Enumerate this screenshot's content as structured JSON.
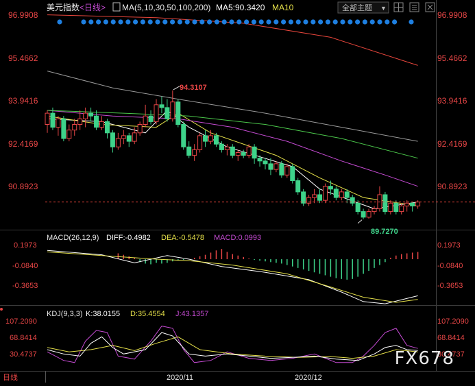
{
  "header": {
    "instrument": "美元指数",
    "period": "<日线>",
    "ma_label": "MA(5,10,30,50,100,200)",
    "ma5_label": "MA5:90.3420",
    "ma10_label": "MA10",
    "theme_button": "全部主题",
    "theme_arrow": "▼",
    "icon_names": [
      "grid-icon",
      "settings-icon"
    ]
  },
  "colors": {
    "background": "#000000",
    "up": "#e84646",
    "down": "#3ed38a",
    "ma5": "#ffffff",
    "ma10": "#e6e14a",
    "ma30": "#c54bd3",
    "ma50": "#4bc84b",
    "ma100": "#9a9a9a",
    "ma200": "#e8463c",
    "axis_text": "#e84646",
    "label_green": "#3ed38a",
    "dea": "#e6e14a",
    "macd_hist": "#c54bd3",
    "kdj_k": "#ffffff",
    "kdj_d": "#e6e14a",
    "kdj_j": "#c54bd3",
    "marker": "#1e7fe0"
  },
  "price_axis": [
    "96.9908",
    "95.4662",
    "93.9416",
    "92.4169",
    "90.8923"
  ],
  "annotations": {
    "high": "94.3107",
    "low": "89.7270"
  },
  "macd": {
    "label": "MACD(26,12,9)",
    "diff_label": "DIFF:-0.4982",
    "dea_label": "DEA:-0.5478",
    "macd_label": "MACD:0.0993",
    "axis": [
      "0.1973",
      "-0.0840",
      "-0.3653"
    ]
  },
  "kdj": {
    "label": "KDJ(9,3,3)",
    "k_label": "K:38.0155",
    "d_label": "D:35.4554",
    "j_label": "J:43.1357",
    "axis": [
      "107.2090",
      "68.8414",
      "30.4737"
    ]
  },
  "x_axis": {
    "dates": [
      "2020/11",
      "2020/12"
    ],
    "period_label": "日线"
  },
  "watermark": "FX678",
  "chart_data": {
    "type": "candlestick",
    "title": "美元指数 <日线>",
    "y_range": [
      89.3,
      97.1
    ],
    "y_ticks": [
      96.9908,
      95.4662,
      93.9416,
      92.4169,
      90.8923
    ],
    "x_ticks": {
      "2020/11": 45,
      "2020/12": 65
    },
    "candles": [
      [
        93.1,
        93.5,
        92.8,
        93.6
      ],
      [
        93.5,
        93.0,
        92.9,
        93.7
      ],
      [
        93.0,
        93.3,
        92.7,
        93.4
      ],
      [
        93.3,
        92.6,
        92.5,
        93.4
      ],
      [
        92.6,
        92.9,
        92.5,
        93.1
      ],
      [
        92.9,
        93.1,
        92.7,
        93.3
      ],
      [
        93.1,
        93.3,
        92.9,
        93.6
      ],
      [
        93.3,
        93.5,
        93.0,
        93.7
      ],
      [
        93.5,
        93.4,
        93.2,
        93.7
      ],
      [
        93.4,
        93.0,
        92.9,
        93.6
      ],
      [
        93.0,
        93.2,
        92.9,
        93.4
      ],
      [
        93.2,
        92.8,
        92.6,
        93.3
      ],
      [
        92.8,
        92.3,
        92.1,
        92.9
      ],
      [
        92.3,
        92.6,
        92.2,
        92.8
      ],
      [
        92.6,
        92.7,
        92.4,
        92.9
      ],
      [
        92.7,
        92.5,
        92.3,
        92.8
      ],
      [
        92.5,
        92.8,
        92.4,
        93.0
      ],
      [
        92.8,
        93.1,
        92.7,
        93.2
      ],
      [
        93.1,
        93.4,
        93.0,
        93.8
      ],
      [
        93.4,
        93.2,
        93.1,
        93.6
      ],
      [
        93.2,
        93.8,
        93.1,
        94.0
      ],
      [
        93.8,
        93.7,
        93.5,
        94.1
      ],
      [
        93.7,
        93.3,
        93.2,
        94.0
      ],
      [
        93.3,
        93.9,
        93.2,
        94.31
      ],
      [
        93.9,
        93.1,
        93.0,
        94.0
      ],
      [
        93.1,
        92.3,
        92.2,
        93.2
      ],
      [
        92.3,
        92.0,
        91.9,
        92.5
      ],
      [
        92.0,
        92.2,
        91.8,
        92.4
      ],
      [
        92.2,
        92.7,
        92.1,
        92.8
      ],
      [
        92.7,
        92.5,
        92.3,
        92.9
      ],
      [
        92.5,
        92.7,
        92.4,
        92.9
      ],
      [
        92.7,
        92.4,
        92.3,
        92.8
      ],
      [
        92.4,
        92.2,
        92.1,
        92.5
      ],
      [
        92.2,
        92.3,
        92.0,
        92.4
      ],
      [
        92.3,
        92.0,
        91.9,
        92.4
      ],
      [
        92.0,
        92.1,
        91.8,
        92.2
      ],
      [
        92.1,
        92.0,
        91.9,
        92.2
      ],
      [
        92.0,
        92.3,
        91.9,
        92.4
      ],
      [
        92.3,
        91.9,
        91.7,
        92.4
      ],
      [
        91.9,
        91.8,
        91.6,
        92.0
      ],
      [
        91.8,
        91.7,
        91.5,
        91.9
      ],
      [
        91.7,
        91.5,
        91.3,
        91.9
      ],
      [
        91.5,
        91.7,
        91.4,
        91.8
      ],
      [
        91.7,
        91.3,
        91.2,
        91.8
      ],
      [
        91.3,
        91.6,
        91.2,
        91.7
      ],
      [
        91.6,
        91.1,
        91.0,
        91.7
      ],
      [
        91.1,
        90.7,
        90.6,
        91.2
      ],
      [
        90.7,
        90.3,
        90.2,
        90.8
      ],
      [
        90.3,
        90.5,
        90.2,
        90.6
      ],
      [
        90.5,
        90.6,
        90.3,
        90.8
      ],
      [
        90.6,
        90.4,
        90.3,
        90.8
      ],
      [
        90.4,
        90.9,
        90.3,
        91.0
      ],
      [
        90.9,
        90.8,
        90.6,
        91.1
      ],
      [
        90.8,
        90.5,
        90.4,
        90.9
      ],
      [
        90.5,
        90.7,
        90.4,
        90.8
      ],
      [
        90.7,
        90.5,
        90.3,
        90.8
      ],
      [
        90.5,
        90.3,
        90.2,
        90.6
      ],
      [
        90.3,
        90.0,
        89.9,
        90.4
      ],
      [
        90.0,
        89.8,
        89.73,
        90.1
      ],
      [
        89.8,
        90.0,
        89.75,
        90.1
      ],
      [
        90.0,
        90.1,
        89.9,
        90.2
      ],
      [
        90.1,
        90.6,
        90.0,
        90.9
      ],
      [
        90.6,
        90.0,
        89.9,
        90.7
      ],
      [
        90.0,
        90.3,
        89.9,
        90.4
      ],
      [
        90.3,
        90.0,
        89.9,
        90.4
      ],
      [
        90.0,
        90.2,
        89.9,
        90.3
      ],
      [
        90.2,
        90.3,
        90.0,
        90.4
      ],
      [
        90.3,
        90.2,
        90.0,
        90.35
      ],
      [
        90.2,
        90.34,
        90.1,
        90.4
      ]
    ],
    "ma_lines": [
      {
        "name": "MA5",
        "points": [
          [
            0,
            93.3
          ],
          [
            10,
            93.2
          ],
          [
            18,
            92.8
          ],
          [
            22,
            93.6
          ],
          [
            26,
            93.0
          ],
          [
            33,
            92.3
          ],
          [
            45,
            91.6
          ],
          [
            50,
            90.8
          ],
          [
            60,
            90.1
          ],
          [
            68,
            90.34
          ]
        ]
      },
      {
        "name": "MA10",
        "points": [
          [
            0,
            93.4
          ],
          [
            10,
            93.1
          ],
          [
            20,
            93.0
          ],
          [
            24,
            93.5
          ],
          [
            30,
            92.8
          ],
          [
            42,
            92.0
          ],
          [
            50,
            91.2
          ],
          [
            58,
            90.5
          ],
          [
            68,
            90.2
          ]
        ]
      },
      {
        "name": "MA30",
        "points": [
          [
            0,
            93.6
          ],
          [
            12,
            93.4
          ],
          [
            24,
            93.3
          ],
          [
            34,
            93.0
          ],
          [
            44,
            92.5
          ],
          [
            54,
            91.8
          ],
          [
            62,
            91.3
          ],
          [
            68,
            90.9
          ]
        ]
      },
      {
        "name": "MA50",
        "points": [
          [
            0,
            93.6
          ],
          [
            14,
            93.5
          ],
          [
            26,
            93.4
          ],
          [
            40,
            93.1
          ],
          [
            54,
            92.6
          ],
          [
            68,
            91.9
          ]
        ]
      },
      {
        "name": "MA100",
        "points": [
          [
            0,
            95.0
          ],
          [
            12,
            94.4
          ],
          [
            24,
            94.0
          ],
          [
            40,
            93.5
          ],
          [
            54,
            93.0
          ],
          [
            68,
            92.5
          ]
        ]
      },
      {
        "name": "MA200",
        "points": [
          [
            0,
            97.0
          ],
          [
            20,
            96.9
          ],
          [
            36,
            96.7
          ],
          [
            52,
            96.2
          ],
          [
            68,
            95.2
          ]
        ]
      }
    ],
    "macd": {
      "axis_ticks": [
        0.1973,
        -0.084,
        -0.3653
      ],
      "hist": [
        0.08,
        0.06,
        0.04,
        0.02,
        -0.04,
        -0.06,
        -0.07,
        -0.05,
        -0.06,
        -0.05,
        -0.03,
        -0.02,
        -0.01,
        0.0,
        0.02,
        0.04,
        0.06,
        0.09,
        0.12,
        0.14,
        0.1,
        0.07,
        0.05,
        0.03,
        0.01,
        -0.01,
        -0.02,
        -0.03,
        -0.04,
        -0.05,
        -0.06,
        -0.08,
        -0.1,
        -0.12,
        -0.14,
        -0.16,
        -0.18,
        -0.2,
        -0.22,
        -0.24,
        -0.26,
        -0.27,
        -0.28,
        -0.27,
        -0.24,
        -0.2,
        -0.16,
        -0.12,
        -0.08,
        -0.04,
        0.02,
        0.05,
        0.07,
        0.08,
        0.09,
        0.099
      ],
      "diff": [
        [
          0,
          0.12
        ],
        [
          10,
          0.06
        ],
        [
          16,
          -0.05
        ],
        [
          22,
          0.05
        ],
        [
          26,
          0.0
        ],
        [
          32,
          -0.1
        ],
        [
          40,
          -0.18
        ],
        [
          48,
          -0.28
        ],
        [
          54,
          -0.45
        ],
        [
          58,
          -0.58
        ],
        [
          62,
          -0.61
        ],
        [
          68,
          -0.5
        ]
      ],
      "dea": [
        [
          0,
          0.1
        ],
        [
          10,
          0.05
        ],
        [
          20,
          0.0
        ],
        [
          26,
          -0.02
        ],
        [
          34,
          -0.08
        ],
        [
          44,
          -0.2
        ],
        [
          52,
          -0.38
        ],
        [
          58,
          -0.52
        ],
        [
          64,
          -0.59
        ],
        [
          68,
          -0.55
        ]
      ]
    },
    "kdj": {
      "axis_ticks": [
        107.209,
        68.8414,
        30.4737
      ],
      "k": [
        [
          0,
          40
        ],
        [
          3,
          30
        ],
        [
          6,
          25
        ],
        [
          8,
          55
        ],
        [
          10,
          70
        ],
        [
          12,
          45
        ],
        [
          14,
          30
        ],
        [
          18,
          40
        ],
        [
          21,
          80
        ],
        [
          23,
          72
        ],
        [
          26,
          30
        ],
        [
          29,
          25
        ],
        [
          33,
          30
        ],
        [
          37,
          25
        ],
        [
          41,
          20
        ],
        [
          45,
          22
        ],
        [
          49,
          25
        ],
        [
          53,
          18
        ],
        [
          57,
          15
        ],
        [
          60,
          30
        ],
        [
          62,
          45
        ],
        [
          64,
          50
        ],
        [
          66,
          40
        ],
        [
          68,
          38
        ]
      ],
      "d": [
        [
          0,
          45
        ],
        [
          4,
          35
        ],
        [
          8,
          40
        ],
        [
          12,
          50
        ],
        [
          16,
          38
        ],
        [
          20,
          55
        ],
        [
          24,
          70
        ],
        [
          28,
          40
        ],
        [
          34,
          30
        ],
        [
          40,
          25
        ],
        [
          46,
          22
        ],
        [
          52,
          24
        ],
        [
          56,
          20
        ],
        [
          60,
          25
        ],
        [
          64,
          40
        ],
        [
          68,
          35
        ]
      ],
      "j": [
        [
          0,
          35
        ],
        [
          3,
          15
        ],
        [
          5,
          10
        ],
        [
          7,
          60
        ],
        [
          9,
          85
        ],
        [
          11,
          80
        ],
        [
          13,
          25
        ],
        [
          16,
          18
        ],
        [
          19,
          60
        ],
        [
          21,
          95
        ],
        [
          23,
          90
        ],
        [
          25,
          40
        ],
        [
          27,
          10
        ],
        [
          30,
          15
        ],
        [
          33,
          35
        ],
        [
          37,
          20
        ],
        [
          41,
          15
        ],
        [
          45,
          20
        ],
        [
          49,
          30
        ],
        [
          53,
          10
        ],
        [
          56,
          10
        ],
        [
          58,
          25
        ],
        [
          60,
          50
        ],
        [
          62,
          80
        ],
        [
          64,
          90
        ],
        [
          66,
          50
        ],
        [
          68,
          43
        ]
      ]
    },
    "markers_count": 43
  }
}
